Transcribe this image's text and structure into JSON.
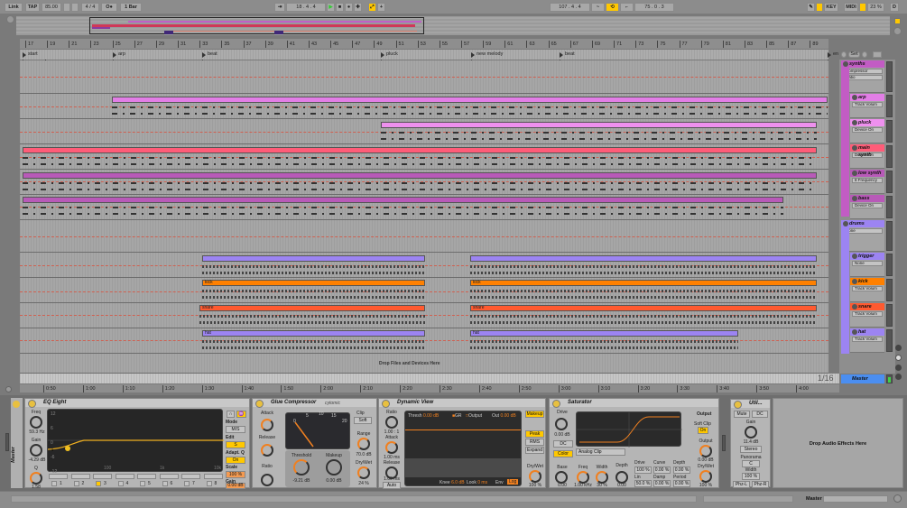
{
  "transport": {
    "link": "Link",
    "tap": "TAP",
    "tempo": "85.00",
    "sig_num": "4",
    "sig_den": "4",
    "metronome": "O●",
    "quantize": "1 Bar",
    "position": "18 .   4 .   4",
    "loop_start": "107 .   4 .   4",
    "loop_length": "75 .   0 .   3",
    "key": "KEY",
    "midi": "MIDI",
    "cpu": "23 %",
    "disk": "D"
  },
  "bar_ruler": [
    "17",
    "19",
    "21",
    "23",
    "25",
    "27",
    "29",
    "31",
    "33",
    "35",
    "37",
    "39",
    "41",
    "43",
    "45",
    "47",
    "49",
    "51",
    "53",
    "55",
    "57",
    "59",
    "61",
    "63",
    "65",
    "67",
    "69",
    "71",
    "73",
    "75",
    "77",
    "79",
    "81",
    "83",
    "85",
    "87",
    "89"
  ],
  "time_ruler": [
    "0:50",
    "1:00",
    "1:10",
    "1:20",
    "1:30",
    "1:40",
    "1:50",
    "2:00",
    "2:10",
    "2:20",
    "2:30",
    "2:40",
    "2:50",
    "3:00",
    "3:10",
    "3:20",
    "3:30",
    "3:40",
    "3:50",
    "4:00"
  ],
  "locators": [
    "start",
    "arp",
    "beat",
    "pluck",
    "new melody",
    "beat",
    "en"
  ],
  "set_button": "Set",
  "tracks": [
    {
      "name": "synths",
      "color": "#c25cc4",
      "device": "Compressor",
      "param": "Ratio"
    },
    {
      "name": "arp",
      "color": "#e27ee6",
      "device": "Track Volum"
    },
    {
      "name": "pluck",
      "color": "#ee90ee",
      "device": "Device On"
    },
    {
      "name": "main synth",
      "color": "#ff5c78",
      "device": "Device On"
    },
    {
      "name": "low synth",
      "color": "#b85ab8",
      "device": "8 Frequency"
    },
    {
      "name": "bass",
      "color": "#b85ab8",
      "device": "Device On"
    },
    {
      "name": "drums",
      "color": "#9c84f2",
      "device": "None"
    },
    {
      "name": "trigger",
      "color": "#9c84f2",
      "device": "None"
    },
    {
      "name": "kick",
      "color": "#ff8000",
      "device": "Track Volum"
    },
    {
      "name": "snare",
      "color": "#ff5a30",
      "device": "Track Volum"
    },
    {
      "name": "hat",
      "color": "#9c84f2",
      "device": "Track Volum"
    },
    {
      "name": "Master",
      "color": "#4b8ef0"
    }
  ],
  "clips": {
    "kick": "kick",
    "snare": "snare",
    "hat": "hat"
  },
  "drop_files": "Drop Files and Devices Here",
  "grid": "1/16",
  "devices": {
    "chain_title": "Master",
    "eq": {
      "title": "EQ Eight",
      "freq_label": "Freq",
      "freq": "59.3 Hz",
      "gain_label": "Gain",
      "gain": "-4.29 dB",
      "q_label": "Q",
      "q": "1.58",
      "y_ticks": [
        "12",
        "6",
        "0",
        "-6",
        "-12"
      ],
      "x_ticks": [
        "100",
        "1k",
        "10k"
      ],
      "band_marker": "3",
      "bands": [
        "1",
        "2",
        "3",
        "4",
        "5",
        "6",
        "7",
        "8"
      ],
      "mode_label": "Mode",
      "mode": "M/S",
      "edit_label": "Edit",
      "edit": "S",
      "adapt_label": "Adapt. Q",
      "adapt": "On",
      "scale_label": "Scale",
      "scale": "100 %",
      "out_gain_label": "Gain",
      "out_gain": "0.00 dB"
    },
    "glue": {
      "title": "Glue Compressor",
      "brand": "cytomic",
      "attack_label": "Attack",
      "release_label": "Release",
      "ratio_label": "Ratio",
      "meter_ticks": [
        "0",
        "5",
        "10",
        "15",
        "20"
      ],
      "threshold_label": "Threshold",
      "threshold": "-9.21 dB",
      "makeup_label": "Makeup",
      "makeup": "0.00 dB",
      "clip_label": "Clip",
      "clip": "Soft",
      "range_label": "Range",
      "range": "70.0 dB",
      "drywet_label": "Dry/Wet",
      "drywet": "24 %"
    },
    "dyn": {
      "title": "Dynamic View",
      "ratio_label": "Ratio",
      "ratio": "1.00 : 1",
      "attack_label": "Attack",
      "attack": "1.00 ms",
      "release_label": "Release",
      "release": "1.00 ms",
      "auto": "Auto",
      "thresh_label": "Thresh",
      "thresh": "0.00 dB",
      "gr": "GR",
      "output": "Output",
      "out_label": "Out",
      "out": "0.00 dB",
      "knee_label": "Knee",
      "knee": "6.0 dB",
      "look_label": "Look",
      "look": "0 ms",
      "env_label": "Env",
      "env": "Log",
      "makeup": "Makeup",
      "peak": "Peak",
      "rms": "RMS",
      "expand": "Expand",
      "drywet_label": "Dry/Wet",
      "drywet": "100 %"
    },
    "sat": {
      "title": "Saturator",
      "drive_label": "Drive",
      "drive": "0.00 dB",
      "dc": "DC",
      "color": "Color",
      "type": "Analog Clip",
      "base_label": "Base",
      "base": "0.00",
      "freq_label": "Freq",
      "freq": "1.00 kHz",
      "width_label": "Width",
      "width": "30 %",
      "depth_label": "Depth",
      "depth": "0.00",
      "p_drive_label": "Drive",
      "p_drive": "100 %",
      "curve_label": "Curve",
      "curve": "0.00 %",
      "p_depth_label": "Depth",
      "p_depth": "0.00 %",
      "lin_label": "Lin",
      "lin": "50.0 %",
      "damp_label": "Damp",
      "damp": "0.00 %",
      "period_label": "Period",
      "period": "0.00 %",
      "output_title": "Output",
      "softclip_label": "Soft Clip",
      "softclip": "On",
      "out_label": "Output",
      "out": "0.00 dB",
      "drywet_label": "Dry/Wet",
      "drywet": "100 %"
    },
    "util": {
      "title": "Util...",
      "mute": "Mute",
      "dc": "DC",
      "gain_label": "Gain",
      "gain": "11.4 dB",
      "mode": "Stereo",
      "pan_label": "Panorama",
      "pan": "C",
      "width_label": "Width",
      "width": "100 %",
      "phz_l": "Phz-L",
      "phz_r": "Phz-R"
    },
    "drop_effects": "Drop Audio Effects Here"
  },
  "status": {
    "track": "Master"
  }
}
